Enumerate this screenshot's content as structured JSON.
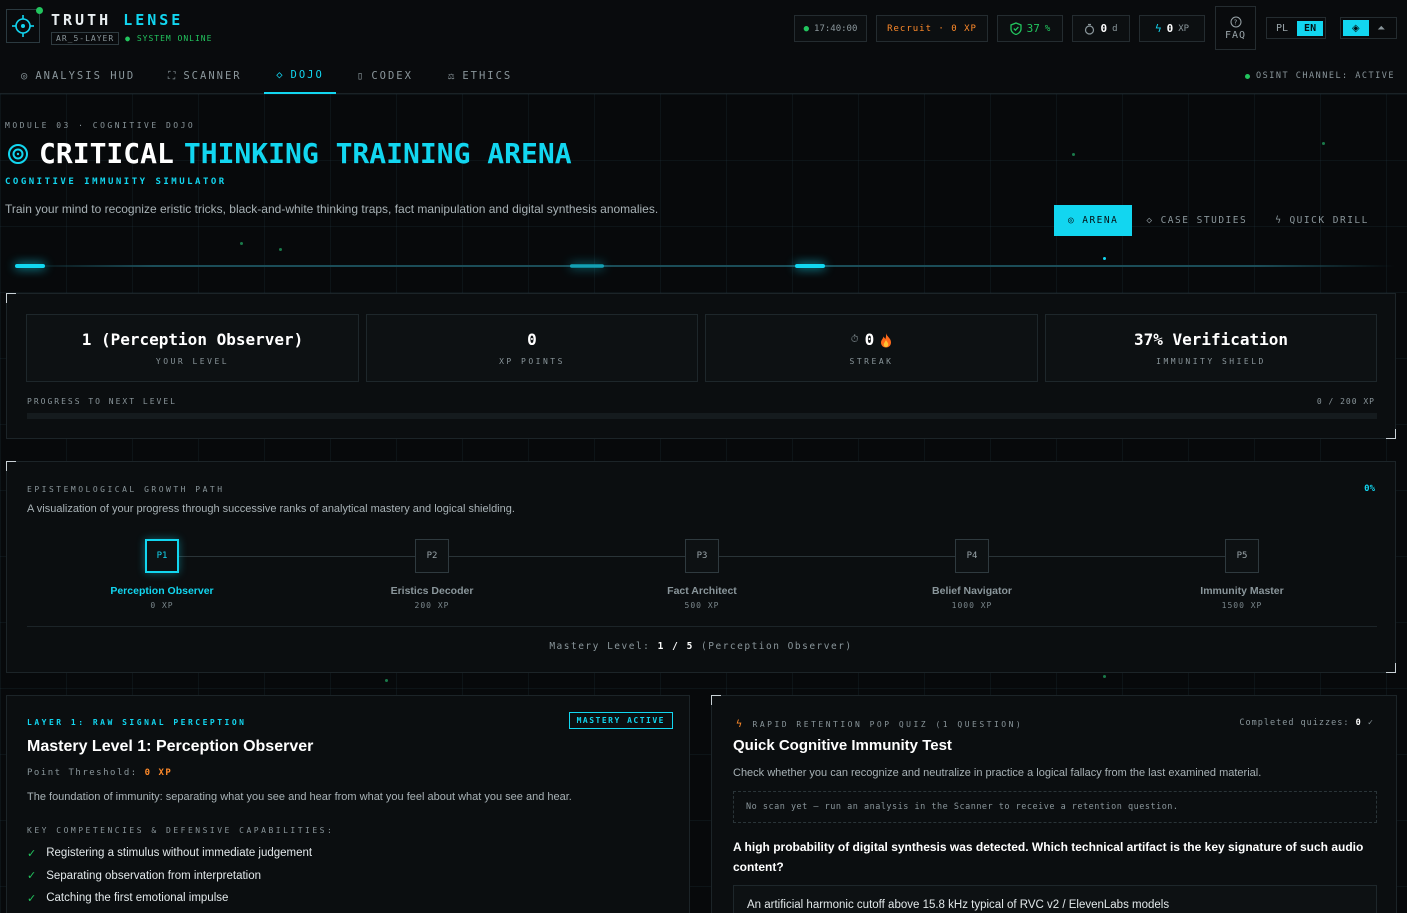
{
  "brand": {
    "name_a": "TRUTH",
    "name_b": "LENSE",
    "layer": "AR_5-LAYER",
    "status": "SYSTEM ONLINE"
  },
  "topbar": {
    "time": "17:40:00",
    "rank": "Recruit · 0 XP",
    "shield_value": "37",
    "shield_unit": "%",
    "streak_value": "0",
    "streak_unit": "d",
    "xp_value": "0",
    "xp_unit": "XP",
    "faq": "FAQ",
    "lang": [
      "PL",
      "EN"
    ],
    "lang_active": "EN"
  },
  "nav": {
    "items": [
      "ANALYSIS HUD",
      "SCANNER",
      "DOJO",
      "CODEX",
      "ETHICS"
    ],
    "active": "DOJO",
    "osint": "OSINT CHANNEL: ACTIVE"
  },
  "hero": {
    "module": "MODULE 03 · COGNITIVE DOJO",
    "title_a": "CRITICAL",
    "title_b": "THINKING TRAINING ARENA",
    "subtitle": "COGNITIVE IMMUNITY SIMULATOR",
    "description": "Train your mind to recognize eristic tricks, black-and-white thinking traps, fact manipulation and digital synthesis anomalies.",
    "tabs": [
      "ARENA",
      "CASE STUDIES",
      "QUICK DRILL"
    ],
    "tab_active": "ARENA"
  },
  "stats": {
    "level": {
      "value": "1 (Perception Observer)",
      "label": "YOUR LEVEL"
    },
    "xp": {
      "value": "0",
      "label": "XP POINTS"
    },
    "streak": {
      "value": "0",
      "label": "STREAK"
    },
    "shield": {
      "value": "37% Verification",
      "label": "IMMUNITY SHIELD"
    },
    "progress_label": "PROGRESS TO NEXT LEVEL",
    "progress_text": "0 / 200 XP",
    "progress_fraction": 0
  },
  "growth_path": {
    "title": "EPISTEMOLOGICAL GROWTH PATH",
    "description": "A visualization of your progress through successive ranks of analytical mastery and logical shielding.",
    "percent": "0%",
    "nodes": [
      {
        "code": "P1",
        "name": "Perception Observer",
        "xp": "0 XP"
      },
      {
        "code": "P2",
        "name": "Eristics Decoder",
        "xp": "200 XP"
      },
      {
        "code": "P3",
        "name": "Fact Architect",
        "xp": "500 XP"
      },
      {
        "code": "P4",
        "name": "Belief Navigator",
        "xp": "1000 XP"
      },
      {
        "code": "P5",
        "name": "Immunity Master",
        "xp": "1500 XP"
      }
    ],
    "mastery_prefix": "Mastery Level:",
    "mastery_current": "1",
    "mastery_sep": "/",
    "mastery_total": "5",
    "mastery_name": "(Perception Observer)"
  },
  "level_card": {
    "kicker": "LAYER 1: RAW SIGNAL PERCEPTION",
    "badge": "MASTERY ACTIVE",
    "title": "Mastery Level 1: Perception Observer",
    "threshold_label": "Point Threshold:",
    "threshold_value": "0 XP",
    "description": "The foundation of immunity: separating what you see and hear from what you feel about what you see and hear.",
    "competencies_title": "KEY COMPETENCIES & DEFENSIVE CAPABILITIES:",
    "competencies": [
      "Registering a stimulus without immediate judgement",
      "Separating observation from interpretation",
      "Catching the first emotional impulse"
    ]
  },
  "quiz": {
    "kicker": "RAPID RETENTION POP QUIZ (1 QUESTION)",
    "completed_label": "Completed quizzes:",
    "completed_value": "0",
    "title": "Quick Cognitive Immunity Test",
    "description": "Check whether you can recognize and neutralize in practice a logical fallacy from the last examined material.",
    "no_scan": "No scan yet — run an analysis in the Scanner to receive a retention question.",
    "question": "A high probability of digital synthesis was detected. Which technical artifact is the key signature of such audio content?",
    "option_1": "An artificial harmonic cutoff above 15.8 kHz typical of RVC v2 / ElevenLabs models"
  },
  "colors": {
    "accent": "#12d6f0",
    "success": "#22c55e",
    "warning": "#ff8a2a",
    "background": "#07090b"
  }
}
